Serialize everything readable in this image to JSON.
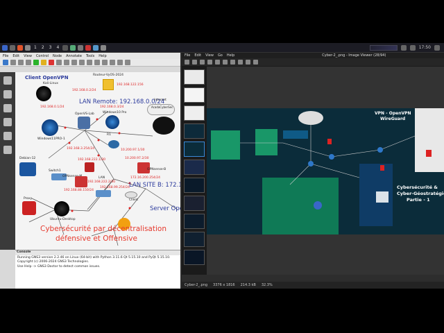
{
  "taskbar": {
    "workspaces": [
      "1",
      "2",
      "3",
      "4",
      "5",
      "6"
    ],
    "clock": "17:50"
  },
  "gns3": {
    "menu": [
      "File",
      "Edit",
      "View",
      "Control",
      "Node",
      "Annotate",
      "Tools",
      "Help"
    ],
    "canvas": {
      "title_client_vpn": "Client OpenVPN",
      "kali": "Kali-Linux",
      "router_title": "Routeur-VyOS-2024",
      "ip_top_left": "192.168.0.2/24",
      "ip_top_right": "192.168.122.156",
      "ip_mid_left": "192.168.0.1/24",
      "ip_mid_right": "192.168.0.3/24",
      "openvpn_lab": "OpenVS-Lab",
      "win10": "Windows10 Pro",
      "internet": "Internet",
      "lan_remote": "LAN Remote: 192.168.0.0/24",
      "cloud_label": "AcadaCyberSec",
      "win11": "Windows11PRO-1",
      "r1": "R1",
      "ip_r1_left": "192.168.3.254/24",
      "ip_r1_right": "10.200.97.1/30",
      "debian": "Debian-12",
      "switch1": "Switch1",
      "opnsense_m": "OPNsense-M",
      "ip_opn_m": "192.168.222.1/30",
      "ip_opn_m2": "10.200.97.2/30",
      "opnsense_b": "OPNsense-B",
      "ip_left_lan": "192.168.222.2/30",
      "proxy": "Proxy",
      "ip_switch": "192.168.88.150/24",
      "ip_lan_b": "192.168.99.254/24",
      "lan_site_b": "LAN SITE B: 172.16",
      "ip_lan_b_right": "172.16.200.254/24",
      "ubuntu": "Ubuntu-Desktop",
      "client": "Client",
      "server": "Server Ope",
      "overlay_line1": "Cybersécurité par décentralisation",
      "overlay_line2": "défensive et Offensive"
    },
    "console": {
      "title": "Console",
      "lines": [
        "Running GNS3 version 2.2.46 on Linux (64-bit) with Python 3.11.6 Qt 5.15.10 and PyQt 5.15.10.",
        "Copyright (c) 2006-2024 GNS3 Technologies.",
        "Use Help -> GNS3 Doctor to detect common issues."
      ]
    }
  },
  "viewer": {
    "menu": [
      "File",
      "Edit",
      "View",
      "Go",
      "Help"
    ],
    "title": "Cyber-2_.png - Image Viewer (28/94)",
    "diagram": {
      "vpn_title_1": "VPN - OpenVPN",
      "vpn_title_2": "WireGuard",
      "cyber_1": "Cybersécurité &",
      "cyber_2": "Cyber-Géostratégie",
      "cyber_3": "Partie - 1"
    },
    "status": {
      "file": "Cyber-2_.png",
      "dims": "3376 x 1816",
      "size": "214.3 kB",
      "zoom": "32.3%"
    }
  },
  "colors": {
    "accent_red": "#e63a2e",
    "label_blue": "#2b3a9c",
    "link_red": "#e83a3a",
    "diagram_bg": "#0b2c3a"
  }
}
